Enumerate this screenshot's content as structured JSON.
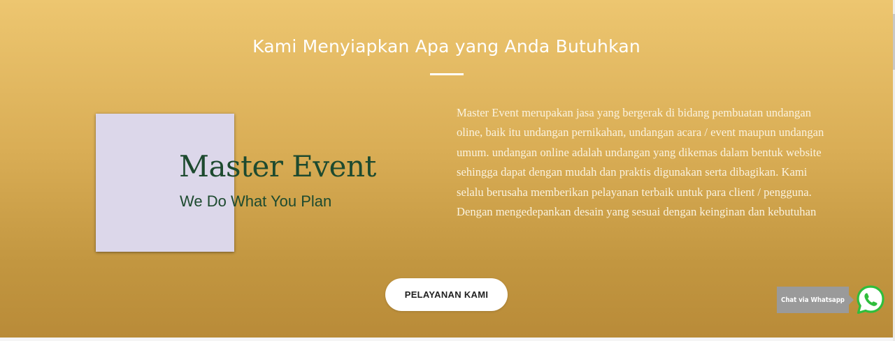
{
  "section": {
    "heading": "Kami Menyiapkan Apa yang Anda Butuhkan",
    "description": "Master Event merupakan jasa yang bergerak di bidang pembuatan undangan oline, baik itu undangan pernikahan, undangan acara / event maupun undangan umum. undangan online adalah undangan yang dikemas dalam bentuk website sehingga dapat dengan mudah dan praktis digunakan serta dibagikan. Kami selalu berusaha memberikan pelayanan terbaik untuk para client / pengguna. Dengan mengedepankan desain yang sesuai dengan keinginan dan kebutuhan",
    "cta_label": "PELAYANAN KAMI"
  },
  "logo": {
    "title": "Master Event",
    "tagline": "We Do What You Plan"
  },
  "whatsapp": {
    "label": "Chat via Whatsapp",
    "icon": "whatsapp-icon"
  },
  "colors": {
    "gradient_top": "#edc670",
    "gradient_bottom": "#b98b38",
    "logo_box": "#dcd7ea",
    "logo_text": "#1d4a2f",
    "whatsapp_green": "#2fbe3c",
    "chat_label_bg": "#9a9a9a"
  }
}
